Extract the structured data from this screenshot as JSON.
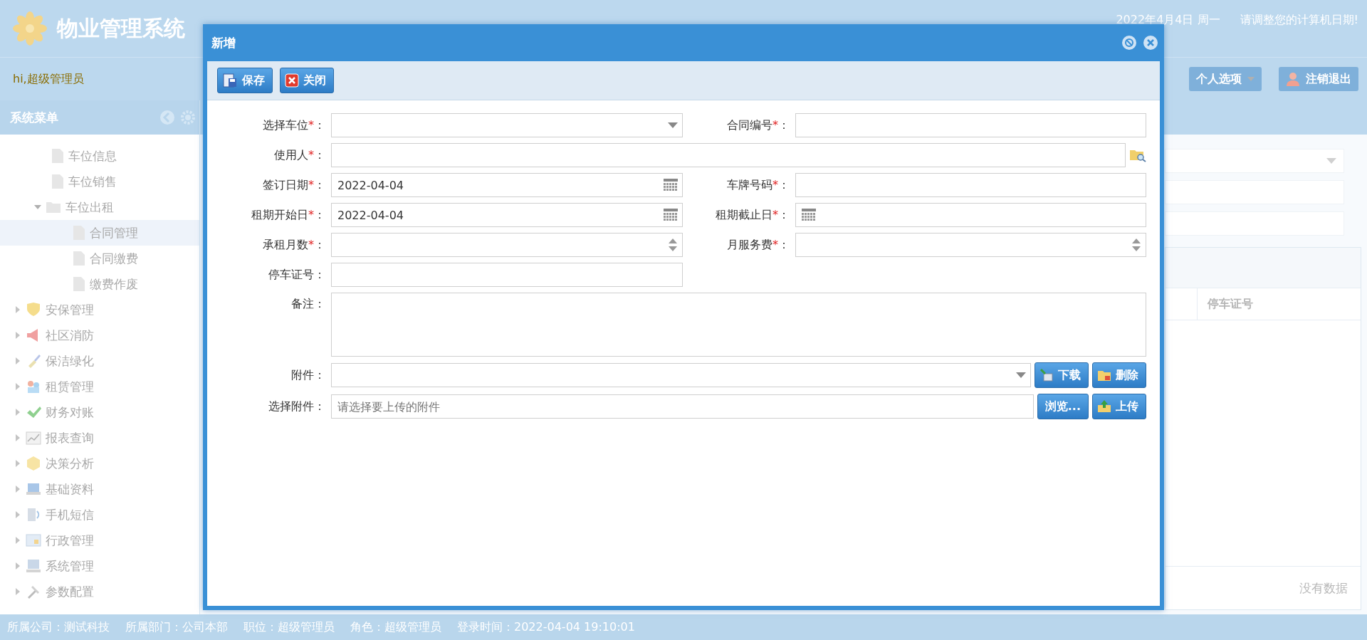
{
  "header": {
    "title": "物业管理系统",
    "date": "2022年4月4日 周一",
    "warning": "请调整您的计算机日期!"
  },
  "user_bar": {
    "greeting": "hi,超级管理员",
    "buttons": [
      {
        "label": "个人选项",
        "kind": "menu"
      },
      {
        "label": "注销退出",
        "kind": "logout"
      }
    ]
  },
  "sidebar": {
    "title": "系统菜单",
    "items": [
      {
        "label": "车位信息",
        "kind": "page",
        "selected": false
      },
      {
        "label": "车位销售",
        "kind": "page",
        "selected": false
      },
      {
        "label": "车位出租",
        "kind": "folder",
        "selected": false,
        "expanded": true,
        "children": [
          {
            "label": "合同管理",
            "kind": "page",
            "selected": true
          },
          {
            "label": "合同缴费",
            "kind": "page",
            "selected": false
          },
          {
            "label": "缴费作废",
            "kind": "page",
            "selected": false
          }
        ]
      }
    ],
    "groups": [
      {
        "label": "安保管理",
        "kind": "security",
        "expanded": false
      },
      {
        "label": "社区消防",
        "kind": "fire",
        "expanded": false
      },
      {
        "label": "保洁绿化",
        "kind": "cleaning",
        "expanded": false
      },
      {
        "label": "租赁管理",
        "kind": "lease",
        "expanded": false
      },
      {
        "label": "财务对账",
        "kind": "finance",
        "expanded": false
      },
      {
        "label": "报表查询",
        "kind": "report",
        "expanded": false
      },
      {
        "label": "决策分析",
        "kind": "analysis",
        "expanded": false
      },
      {
        "label": "基础资料",
        "kind": "basic",
        "expanded": false
      },
      {
        "label": "手机短信",
        "kind": "sms",
        "expanded": false
      },
      {
        "label": "行政管理",
        "kind": "admin",
        "expanded": false
      },
      {
        "label": "系统管理",
        "kind": "system",
        "expanded": false
      },
      {
        "label": "参数配置",
        "kind": "config",
        "expanded": false
      }
    ]
  },
  "content": {
    "grid": {
      "columns": [
        "停车证号"
      ],
      "empty_text": "没有数据"
    }
  },
  "dialog": {
    "title": "新增",
    "toolbar": [
      {
        "label": "保存",
        "kind": "save"
      },
      {
        "label": "关闭",
        "kind": "close"
      }
    ],
    "rows": [
      [
        {
          "label": "选择车位",
          "required_mark": "*",
          "colon": "：",
          "kind": "select"
        },
        {
          "label": "合同编号",
          "required_mark": "*",
          "colon": "：",
          "kind": "text"
        }
      ],
      [
        {
          "label": "使用人",
          "required_mark": "*",
          "colon": "：",
          "kind": "lookup"
        }
      ],
      [
        {
          "label": "签订日期",
          "required_mark": "*",
          "colon": "：",
          "kind": "date",
          "value": "2022-04-04"
        },
        {
          "label": "车牌号码",
          "required_mark": "*",
          "colon": "：",
          "kind": "text"
        }
      ],
      [
        {
          "label": "租期开始日",
          "required_mark": "*",
          "colon": "：",
          "kind": "date",
          "value": "2022-04-04"
        },
        {
          "label": "租期截止日",
          "required_mark": "*",
          "colon": "：",
          "kind": "date"
        }
      ],
      [
        {
          "label": "承租月数",
          "required_mark": "*",
          "colon": "：",
          "kind": "spinner"
        },
        {
          "label": "月服务费",
          "required_mark": "*",
          "colon": "：",
          "kind": "spinner"
        }
      ],
      [
        {
          "label": "停车证号",
          "colon": "：",
          "kind": "text"
        }
      ],
      [
        {
          "label": "备注",
          "colon": "：",
          "kind": "textarea"
        }
      ],
      [
        {
          "label": "附件",
          "colon": "：",
          "kind": "attachment",
          "buttons": [
            {
              "label": "下载",
              "kind": "download"
            },
            {
              "label": "删除",
              "kind": "delete"
            }
          ]
        }
      ],
      [
        {
          "label": "选择附件",
          "colon": "：",
          "kind": "file",
          "placeholder": "请选择要上传的附件",
          "buttons": [
            {
              "label": "浏览...",
              "kind": "browse"
            },
            {
              "label": "上传",
              "kind": "upload"
            }
          ]
        }
      ]
    ]
  },
  "status_bar": [
    "所属公司：测试科技",
    "所属部门：公司本部",
    "职位：超级管理员",
    "角色：超级管理员",
    "登录时间：2022-04-04 19:10:01"
  ]
}
